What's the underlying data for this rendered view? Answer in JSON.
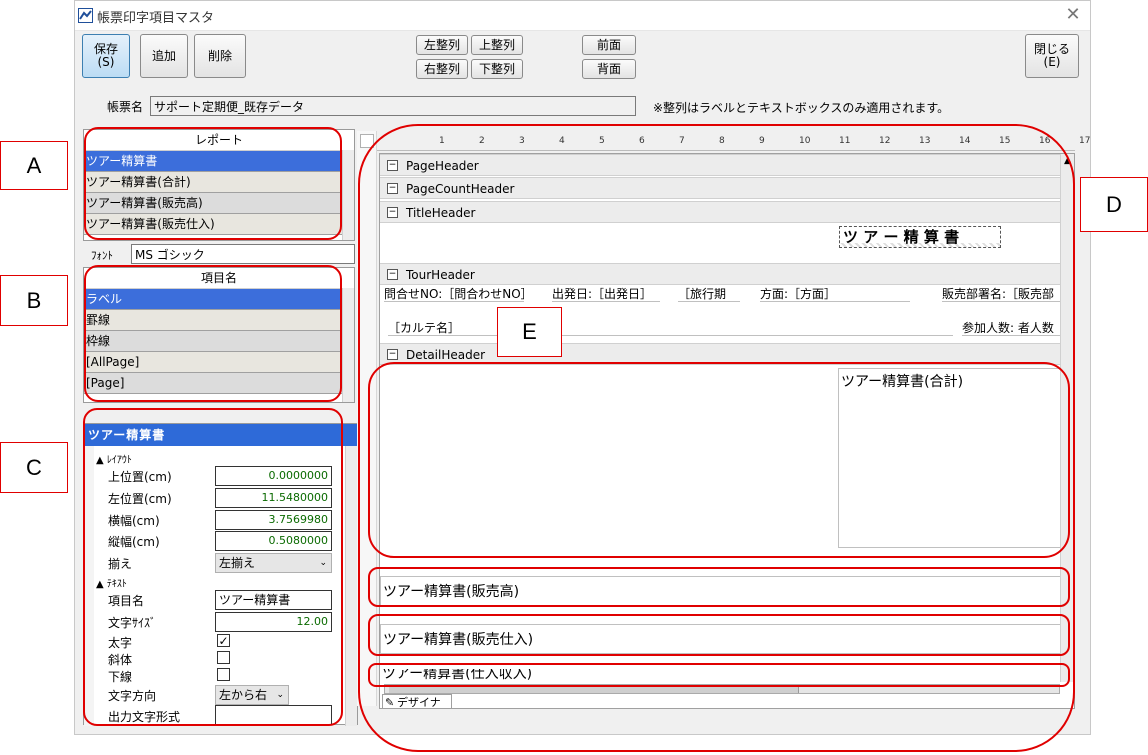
{
  "window": {
    "title": "帳票印字項目マスタ",
    "close_glyph": "✕"
  },
  "toolbar": {
    "save": "保存\n(S)",
    "add": "追加",
    "delete": "削除",
    "align_left": "左整列",
    "align_top": "上整列",
    "align_right": "右整列",
    "align_bottom": "下整列",
    "front": "前面",
    "back": "背面",
    "close": "閉じる\n(E)"
  },
  "form_name": {
    "label": "帳票名",
    "value": "サポート定期便_既存データ"
  },
  "note": "※整列はラベルとテキストボックスのみ適用されます。",
  "report_panel": {
    "header": "レポート",
    "items": [
      "ツアー精算書",
      "ツアー精算書(合計)",
      "ツアー精算書(販売高)",
      "ツアー精算書(販売仕入)"
    ]
  },
  "font": {
    "label": "ﾌｫﾝﾄ",
    "value": "MS ゴシック"
  },
  "item_panel": {
    "header": "項目名",
    "items": [
      "ラベル",
      "罫線",
      "枠線",
      "[AllPage]",
      "[Page]"
    ]
  },
  "properties": {
    "title": "ツアー精算書",
    "layout_category": "ﾚｲｱｳﾄ",
    "top_label": "上位置(cm)",
    "top_value": "0.0000000",
    "left_label": "左位置(cm)",
    "left_value": "11.5480000",
    "width_label": "横幅(cm)",
    "width_value": "3.7569980",
    "height_label": "縦幅(cm)",
    "height_value": "0.5080000",
    "align_label": "揃え",
    "align_value": "左揃え",
    "text_category": "ﾃｷｽﾄ",
    "name_label": "項目名",
    "name_value": "ツアー精算書",
    "size_label": "文字ｻｲｽﾞ",
    "size_value": "12.00",
    "bold_label": "太字",
    "bold_mark": "✓",
    "italic_label": "斜体",
    "underline_label": "下線",
    "direction_label": "文字方向",
    "direction_value": "左から右",
    "format_label": "出力文字形式"
  },
  "designer": {
    "ruler": [
      "1",
      "2",
      "3",
      "4",
      "5",
      "6",
      "7",
      "8",
      "9",
      "10",
      "11",
      "12",
      "13",
      "14",
      "15",
      "16",
      "17"
    ],
    "bands": {
      "page_header": "PageHeader",
      "page_count_header": "PageCountHeader",
      "title_header": "TitleHeader",
      "tour_header": "TourHeader",
      "detail_header": "DetailHeader"
    },
    "title_text": "ツ ア ー 精 算 書",
    "tour": {
      "inquiry": "問合せNO:［問合わせNO］",
      "departure": "出発日:［出発日］",
      "period": "［旅行期",
      "direction": "方面:［方面］",
      "dept": "販売部署名:［販売部",
      "karte": "［カルテ名］",
      "participants": "参加人数: 者人数"
    },
    "summary_label": "ツアー精算書(合計)",
    "sales_label": "ツアー精算書(販売高)",
    "purchase_label": "ツアー精算書(販売仕入)",
    "cut_label": "ツアー精算書(仕入収入)",
    "tab_label": "デザイナ"
  },
  "annotations": {
    "a": "A",
    "b": "B",
    "c": "C",
    "d": "D",
    "e": "E"
  },
  "colors": {
    "selection": "#3c6edb",
    "annotation": "#e00000",
    "property_header": "#2e6ad8"
  }
}
